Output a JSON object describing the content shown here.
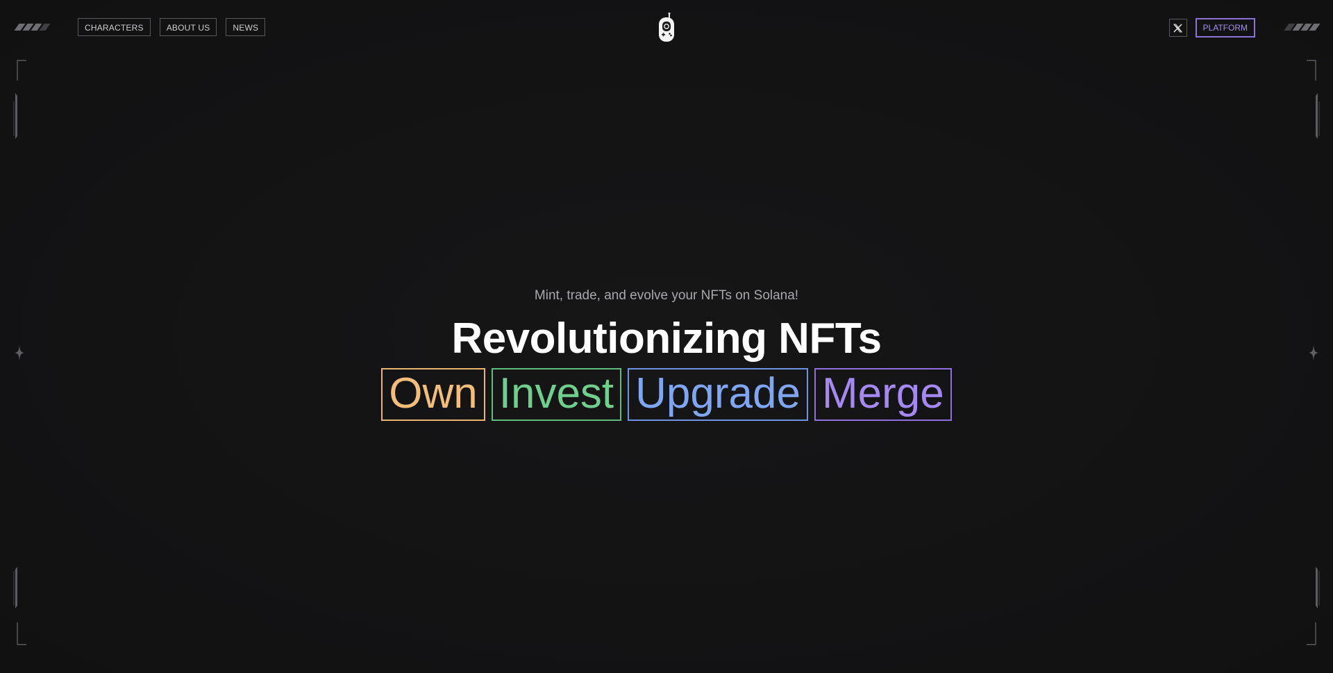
{
  "header": {
    "nav_left": [
      "CHARACTERS",
      "ABOUT US",
      "NEWS"
    ],
    "logo_icon": "game-device-icon",
    "x_icon": "x-logo-icon",
    "platform_label": "PLATFORM"
  },
  "hero": {
    "subtitle": "Mint, trade, and evolve your NFTs on Solana!",
    "headline": "Revolutionizing NFTs",
    "words": [
      {
        "label": "Own",
        "color": "#f2be79"
      },
      {
        "label": "Invest",
        "color": "#6fcf8c"
      },
      {
        "label": "Upgrade",
        "color": "#7fa6f2"
      },
      {
        "label": "Merge",
        "color": "#a489f3"
      }
    ]
  },
  "colors": {
    "background": "#131314",
    "platform_accent": "#8b74d9"
  }
}
